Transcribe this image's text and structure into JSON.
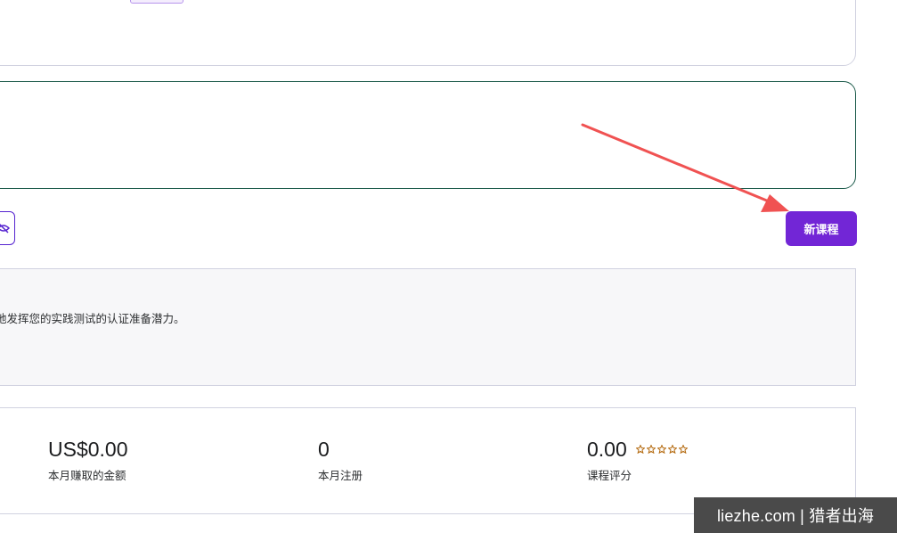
{
  "toolbar": {
    "new_course_label": "新课程"
  },
  "info_panel": {
    "text": "地发挥您的实践测试的认证准备潜力。"
  },
  "stats": [
    {
      "value": "US$0.00",
      "label": "本月赚取的金额"
    },
    {
      "value": "0",
      "label": "本月注册"
    },
    {
      "value": "0.00",
      "label": "课程评分"
    }
  ],
  "rating": {
    "stars_total": 5,
    "stars_filled": 0
  },
  "watermark": {
    "text": "liezhe.com | 猎者出海"
  },
  "colors": {
    "accent": "#7226d6",
    "green_border": "#1e5c4c",
    "annotation_arrow": "#f05252",
    "star": "#b4690e"
  }
}
